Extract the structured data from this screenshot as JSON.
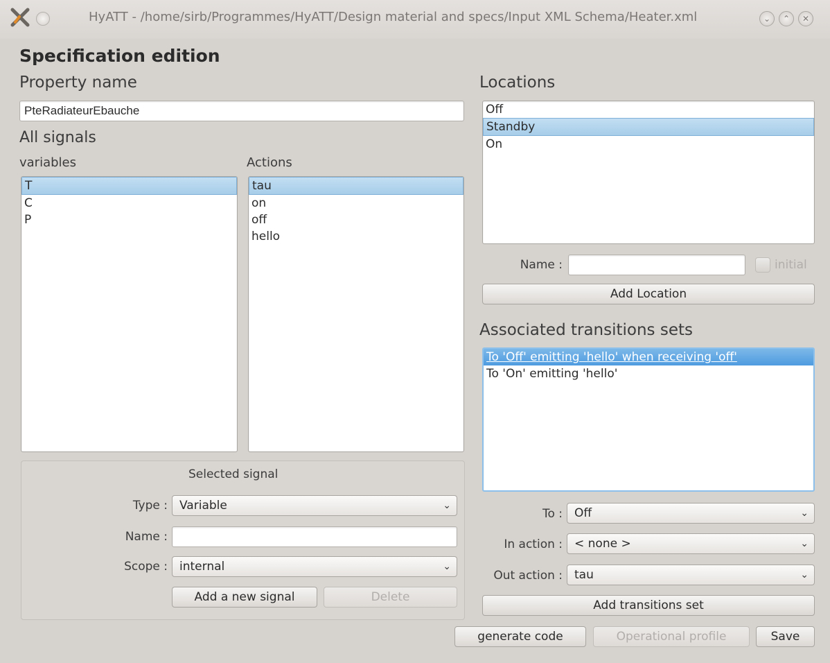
{
  "window": {
    "title": "HyATT - /home/sirb/Programmes/HyATT/Design material and specs/Input XML Schema/Heater.xml"
  },
  "dialog": {
    "heading": "Specification edition"
  },
  "left": {
    "property_name_label": "Property name",
    "property_name_value": "PteRadiateurEbauche",
    "all_signals_label": "All signals",
    "variables_label": "variables",
    "actions_label": "Actions",
    "variables": [
      "T",
      "C",
      "P"
    ],
    "actions": [
      "tau",
      "on",
      "off",
      "hello"
    ],
    "selected_signal": {
      "title": "Selected signal",
      "type_label": "Type :",
      "type_value": "Variable",
      "name_label": "Name :",
      "name_value": "",
      "scope_label": "Scope :",
      "scope_value": "internal",
      "add_button": "Add a new signal",
      "delete_button": "Delete"
    }
  },
  "right": {
    "locations_label": "Locations",
    "locations": [
      "Off",
      "Standby",
      "On"
    ],
    "name_label": "Name :",
    "name_value": "",
    "initial_label": "initial",
    "add_location_button": "Add Location",
    "transitions_label": "Associated transitions sets",
    "transitions": [
      "To 'Off' emitting 'hello' when receiving 'off'",
      "To 'On' emitting 'hello'"
    ],
    "to_label": "To :",
    "to_value": "Off",
    "in_action_label": "In action :",
    "in_action_value": "< none >",
    "out_action_label": "Out action :",
    "out_action_value": "tau",
    "add_transitions_button": "Add transitions set"
  },
  "footer": {
    "generate_button": "generate code",
    "profile_button": "Operational profile",
    "save_button": "Save"
  }
}
